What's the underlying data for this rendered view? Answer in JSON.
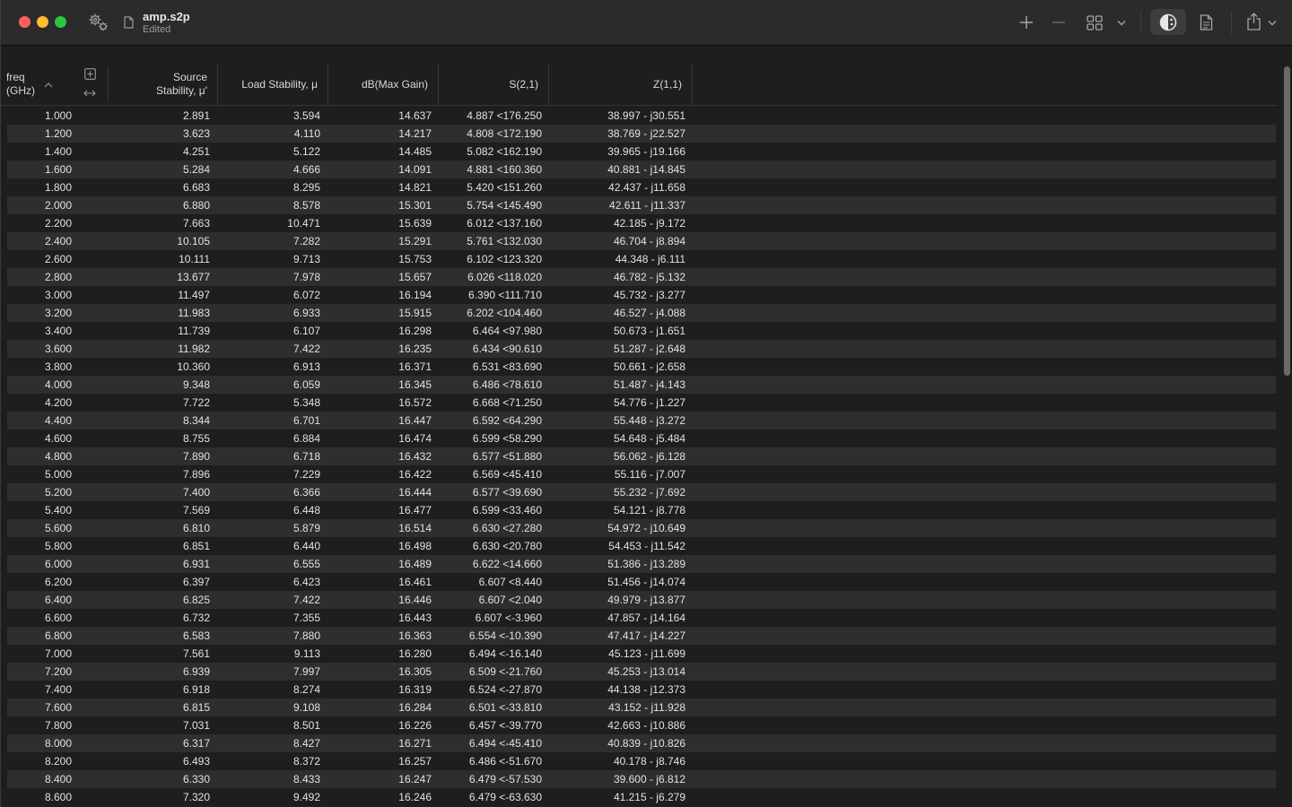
{
  "window": {
    "title": "amp.s2p",
    "subtitle": "Edited"
  },
  "toolbar": {
    "icons": [
      "settings-gears-icon",
      "document-icon",
      "plus-icon",
      "minus-icon",
      "grid-view-icon",
      "chevron-down-icon",
      "appearance-toggle-icon",
      "document-page-icon",
      "share-icon",
      "chevron-down-icon"
    ]
  },
  "table": {
    "columns": {
      "freq": "freq\n(GHz)",
      "source_stability": "Source\nStability, μ'",
      "load_stability": "Load Stability, μ",
      "db_max_gain": "dB(Max Gain)",
      "s21": "S(2,1)",
      "z11": "Z(1,1)"
    },
    "rows": [
      {
        "freq": "1.000",
        "src": "2.891",
        "load": "3.594",
        "db": "14.637",
        "s21": "4.887 <176.250",
        "z11": "38.997 - j30.551"
      },
      {
        "freq": "1.200",
        "src": "3.623",
        "load": "4.110",
        "db": "14.217",
        "s21": "4.808 <172.190",
        "z11": "38.769 - j22.527"
      },
      {
        "freq": "1.400",
        "src": "4.251",
        "load": "5.122",
        "db": "14.485",
        "s21": "5.082 <162.190",
        "z11": "39.965 - j19.166"
      },
      {
        "freq": "1.600",
        "src": "5.284",
        "load": "4.666",
        "db": "14.091",
        "s21": "4.881 <160.360",
        "z11": "40.881 - j14.845"
      },
      {
        "freq": "1.800",
        "src": "6.683",
        "load": "8.295",
        "db": "14.821",
        "s21": "5.420 <151.260",
        "z11": "42.437 - j11.658"
      },
      {
        "freq": "2.000",
        "src": "6.880",
        "load": "8.578",
        "db": "15.301",
        "s21": "5.754 <145.490",
        "z11": "42.611 - j11.337"
      },
      {
        "freq": "2.200",
        "src": "7.663",
        "load": "10.471",
        "db": "15.639",
        "s21": "6.012 <137.160",
        "z11": "42.185 - j9.172"
      },
      {
        "freq": "2.400",
        "src": "10.105",
        "load": "7.282",
        "db": "15.291",
        "s21": "5.761 <132.030",
        "z11": "46.704 - j8.894"
      },
      {
        "freq": "2.600",
        "src": "10.111",
        "load": "9.713",
        "db": "15.753",
        "s21": "6.102 <123.320",
        "z11": "44.348 - j6.111"
      },
      {
        "freq": "2.800",
        "src": "13.677",
        "load": "7.978",
        "db": "15.657",
        "s21": "6.026 <118.020",
        "z11": "46.782 - j5.132"
      },
      {
        "freq": "3.000",
        "src": "11.497",
        "load": "6.072",
        "db": "16.194",
        "s21": "6.390 <111.710",
        "z11": "45.732 - j3.277"
      },
      {
        "freq": "3.200",
        "src": "11.983",
        "load": "6.933",
        "db": "15.915",
        "s21": "6.202 <104.460",
        "z11": "46.527 - j4.088"
      },
      {
        "freq": "3.400",
        "src": "11.739",
        "load": "6.107",
        "db": "16.298",
        "s21": "6.464 <97.980",
        "z11": "50.673 - j1.651"
      },
      {
        "freq": "3.600",
        "src": "11.982",
        "load": "7.422",
        "db": "16.235",
        "s21": "6.434 <90.610",
        "z11": "51.287 - j2.648"
      },
      {
        "freq": "3.800",
        "src": "10.360",
        "load": "6.913",
        "db": "16.371",
        "s21": "6.531 <83.690",
        "z11": "50.661 - j2.658"
      },
      {
        "freq": "4.000",
        "src": "9.348",
        "load": "6.059",
        "db": "16.345",
        "s21": "6.486 <78.610",
        "z11": "51.487 - j4.143"
      },
      {
        "freq": "4.200",
        "src": "7.722",
        "load": "5.348",
        "db": "16.572",
        "s21": "6.668 <71.250",
        "z11": "54.776 - j1.227"
      },
      {
        "freq": "4.400",
        "src": "8.344",
        "load": "6.701",
        "db": "16.447",
        "s21": "6.592 <64.290",
        "z11": "55.448 - j3.272"
      },
      {
        "freq": "4.600",
        "src": "8.755",
        "load": "6.884",
        "db": "16.474",
        "s21": "6.599 <58.290",
        "z11": "54.648 - j5.484"
      },
      {
        "freq": "4.800",
        "src": "7.890",
        "load": "6.718",
        "db": "16.432",
        "s21": "6.577 <51.880",
        "z11": "56.062 - j6.128"
      },
      {
        "freq": "5.000",
        "src": "7.896",
        "load": "7.229",
        "db": "16.422",
        "s21": "6.569 <45.410",
        "z11": "55.116 - j7.007"
      },
      {
        "freq": "5.200",
        "src": "7.400",
        "load": "6.366",
        "db": "16.444",
        "s21": "6.577 <39.690",
        "z11": "55.232 - j7.692"
      },
      {
        "freq": "5.400",
        "src": "7.569",
        "load": "6.448",
        "db": "16.477",
        "s21": "6.599 <33.460",
        "z11": "54.121 - j8.778"
      },
      {
        "freq": "5.600",
        "src": "6.810",
        "load": "5.879",
        "db": "16.514",
        "s21": "6.630 <27.280",
        "z11": "54.972 - j10.649"
      },
      {
        "freq": "5.800",
        "src": "6.851",
        "load": "6.440",
        "db": "16.498",
        "s21": "6.630 <20.780",
        "z11": "54.453 - j11.542"
      },
      {
        "freq": "6.000",
        "src": "6.931",
        "load": "6.555",
        "db": "16.489",
        "s21": "6.622 <14.660",
        "z11": "51.386 - j13.289"
      },
      {
        "freq": "6.200",
        "src": "6.397",
        "load": "6.423",
        "db": "16.461",
        "s21": "6.607 <8.440",
        "z11": "51.456 - j14.074"
      },
      {
        "freq": "6.400",
        "src": "6.825",
        "load": "7.422",
        "db": "16.446",
        "s21": "6.607 <2.040",
        "z11": "49.979 - j13.877"
      },
      {
        "freq": "6.600",
        "src": "6.732",
        "load": "7.355",
        "db": "16.443",
        "s21": "6.607 <-3.960",
        "z11": "47.857 - j14.164"
      },
      {
        "freq": "6.800",
        "src": "6.583",
        "load": "7.880",
        "db": "16.363",
        "s21": "6.554 <-10.390",
        "z11": "47.417 - j14.227"
      },
      {
        "freq": "7.000",
        "src": "7.561",
        "load": "9.113",
        "db": "16.280",
        "s21": "6.494 <-16.140",
        "z11": "45.123 - j11.699"
      },
      {
        "freq": "7.200",
        "src": "6.939",
        "load": "7.997",
        "db": "16.305",
        "s21": "6.509 <-21.760",
        "z11": "45.253 - j13.014"
      },
      {
        "freq": "7.400",
        "src": "6.918",
        "load": "8.274",
        "db": "16.319",
        "s21": "6.524 <-27.870",
        "z11": "44.138 - j12.373"
      },
      {
        "freq": "7.600",
        "src": "6.815",
        "load": "9.108",
        "db": "16.284",
        "s21": "6.501 <-33.810",
        "z11": "43.152 - j11.928"
      },
      {
        "freq": "7.800",
        "src": "7.031",
        "load": "8.501",
        "db": "16.226",
        "s21": "6.457 <-39.770",
        "z11": "42.663 - j10.886"
      },
      {
        "freq": "8.000",
        "src": "6.317",
        "load": "8.427",
        "db": "16.271",
        "s21": "6.494 <-45.410",
        "z11": "40.839 - j10.826"
      },
      {
        "freq": "8.200",
        "src": "6.493",
        "load": "8.372",
        "db": "16.257",
        "s21": "6.486 <-51.670",
        "z11": "40.178 - j8.746"
      },
      {
        "freq": "8.400",
        "src": "6.330",
        "load": "8.433",
        "db": "16.247",
        "s21": "6.479 <-57.530",
        "z11": "39.600 - j6.812"
      },
      {
        "freq": "8.600",
        "src": "7.320",
        "load": "9.492",
        "db": "16.246",
        "s21": "6.479 <-63.630",
        "z11": "41.215 - j6.279"
      }
    ]
  },
  "colors": {
    "background": "#1e1e1e",
    "titlebar": "#2b2b2b",
    "row_alt": "#2e2e2e",
    "close": "#fe5f57",
    "minimize": "#febc2e",
    "zoom": "#28c840"
  }
}
